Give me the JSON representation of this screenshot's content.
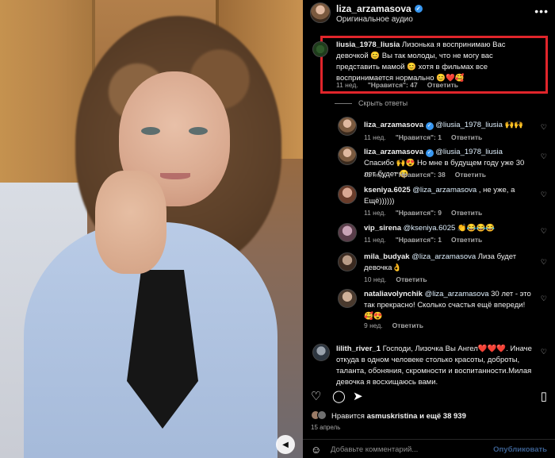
{
  "header": {
    "username": "liza_arzamasova",
    "subtitle": "Оригинальное аудио",
    "menu_icon": "more-dots-icon"
  },
  "comments": [
    {
      "user": "liusia_1978_liusia",
      "text": "Лизонька я воспринимаю Вас девочкой 😊 Вы так молоды, что не могу вас представить мамой 😊 хотя в фильмах все воспринимается нормально 😊❤️🥰",
      "time": "11 нед.",
      "likes": "\"Нравится\": 47",
      "reply": "Ответить"
    }
  ],
  "hide_replies": "Скрыть ответы",
  "replies": [
    {
      "user": "liza_arzamasova",
      "verified": true,
      "mention": "@liusia_1978_liusia",
      "text": " 🙌🙌",
      "time": "11 нед.",
      "likes": "\"Нравится\": 1",
      "reply": "Ответить"
    },
    {
      "user": "liza_arzamasova",
      "verified": true,
      "mention": "@liusia_1978_liusia",
      "text": " Спасибо 🙌😍 Но мне в будущем году уже 30 лет будет 😆",
      "time": "11 нед.",
      "likes": "\"Нравится\": 38",
      "reply": "Ответить"
    },
    {
      "user": "kseniya.6025",
      "mention": "@liza_arzamasova",
      "text": " , не уже, а Ещё))))))",
      "time": "11 нед.",
      "likes": "\"Нравится\": 9",
      "reply": "Ответить"
    },
    {
      "user": "vip_sirena",
      "mention": "@kseniya.6025",
      "text": " 👏😂😂😂",
      "time": "11 нед.",
      "likes": "\"Нравится\": 1",
      "reply": "Ответить"
    },
    {
      "user": "mila_budyak",
      "mention": "@liza_arzamasova",
      "text": " Лиза будет девочка👌",
      "time": "10 нед.",
      "likes": "",
      "reply": "Ответить"
    },
    {
      "user": "nataliavolynchik",
      "mention": "@liza_arzamasova",
      "text": " 30 лет - это так прекрасно! Сколько счастья ещё впереди! 🥰😍",
      "time": "9 нед.",
      "likes": "",
      "reply": "Ответить"
    }
  ],
  "last_comment": {
    "user": "lilith_river_1",
    "text": " Господи, Лизочка Вы Ангел❤️❤️❤️. Иначе откуда в одном человеке столько красоты, доброты, таланта, обоняния, скромности и воспитанности.Милая девочка я восхищаюсь вами."
  },
  "actions": {
    "like_icon": "heart-icon",
    "comment_icon": "comment-icon",
    "share_icon": "share-icon",
    "save_icon": "bookmark-icon"
  },
  "likes_prefix": "Нравится ",
  "likes_user": "asmuskristina",
  "likes_suffix": " и ещё 38 939",
  "date": "15 апрель",
  "add_comment_placeholder": "Добавьте комментарий...",
  "publish_label": "Опубликовать",
  "colors": {
    "highlight_box": "#e0252b",
    "verified": "#3897f0",
    "background": "#000000"
  }
}
